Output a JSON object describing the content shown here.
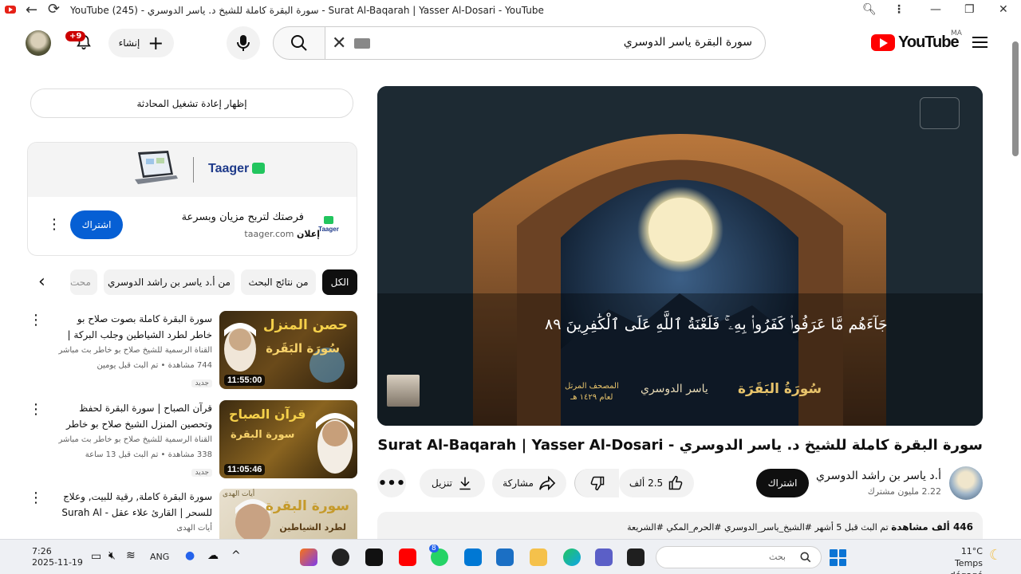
{
  "window": {
    "title": "YouTube (245) - سورة البقرة كاملة للشيخ د. ياسر الدوسري - Surat Al-Baqarah | Yasser Al-Dosari - YouTube"
  },
  "header": {
    "search_query": "سورة البقرة ياسر الدوسري",
    "create_label": "إنشاء",
    "notification_count": "+9",
    "logo_text": "YouTube",
    "country_code": "MA"
  },
  "sidebar": {
    "chat_replay_label": "إظهار إعادة تشغيل المحادثة",
    "ad": {
      "brand": "Taager",
      "title": "فرصتك لتربح مزيان وبسرعة",
      "tag": "إعلان",
      "domain": "taager.com",
      "subscribe_label": "اشتراك",
      "icon_text": "Taager"
    },
    "chips": [
      "الكل",
      "من نتائج البحث",
      "من أ.د ياسر بن راشد الدوسري",
      "محت"
    ],
    "recommendations": [
      {
        "title": "سورة البقرة كاملة بصوت صلاح بو خاطر لطرد الشياطين وجلب البركة | Surah Al...",
        "channel": "القناة الرسمية للشيخ صلاح بو خاطر بث مباشر",
        "meta": "744 مشاهدة • تم البث قبل يومين",
        "badge": "جديد",
        "duration": "11:55:00",
        "thumb_text_top": "حصن المنزل",
        "thumb_text_bottom": "سُورَة البَقَرة"
      },
      {
        "title": "قرآن الصباح | سورة البقرة لحفظ وتحصين المنزل الشيخ صلاح بو خاطر",
        "channel": "القناة الرسمية للشيخ صلاح بو خاطر بث مباشر",
        "meta": "338 مشاهدة • تم البث قبل 13 ساعة",
        "badge": "جديد",
        "duration": "11:05:46",
        "thumb_text_top": "قرآن الصباح",
        "thumb_text_bottom": "سورة البقرة"
      },
      {
        "title": "سورة البقرة كاملة, رقية للبيت, وعلاج للسحر | القارئ علاء عقل - Surah Al Baqarah",
        "channel": "أيات الهدى",
        "meta": "",
        "badge": "",
        "duration": "",
        "thumb_text_top": "سورة البقرة",
        "thumb_text_bottom": "لطرد الشياطين"
      }
    ]
  },
  "player": {
    "verse_text": "جَآءَهُم مَّا عَرَفُوا۟ كَفَرُوا۟ بِهِۦ ۚ فَلَعْنَةُ ٱللَّهِ عَلَى ٱلْكَٰفِرِينَ ٨٩",
    "surah_logo": "سُورَةُ البَقَرَة",
    "reciter_logo": "ياسر الدوسري",
    "mushaf_line1": "المصحف المرتل",
    "mushaf_line2": "لعام ١٤٢٩ هـ"
  },
  "video": {
    "title": "سورة البقرة كاملة للشيخ د. ياسر الدوسري - Surat Al-Baqarah | Yasser Al-Dosari",
    "channel_name": "أ.د ياسر بن راشد الدوسري",
    "subscribers": "2.22 مليون مشترك",
    "subscribe_label": "اشتراك",
    "likes": "2.5 ألف",
    "share_label": "مشاركة",
    "download_label": "تنزيل",
    "description_views": "446 ألف مشاهدة",
    "description_rest": "تم البث قبل 5 أشهر  #الشيخ_ياسر_الدوسري #الحرم_المكي #الشريعة"
  },
  "taskbar": {
    "time": "7:26",
    "date": "2025-11-19",
    "lang": "ANG",
    "search_placeholder": "بحث",
    "temperature": "11°C",
    "weather_text": "Temps dégagé",
    "whatsapp_badge": "8"
  }
}
